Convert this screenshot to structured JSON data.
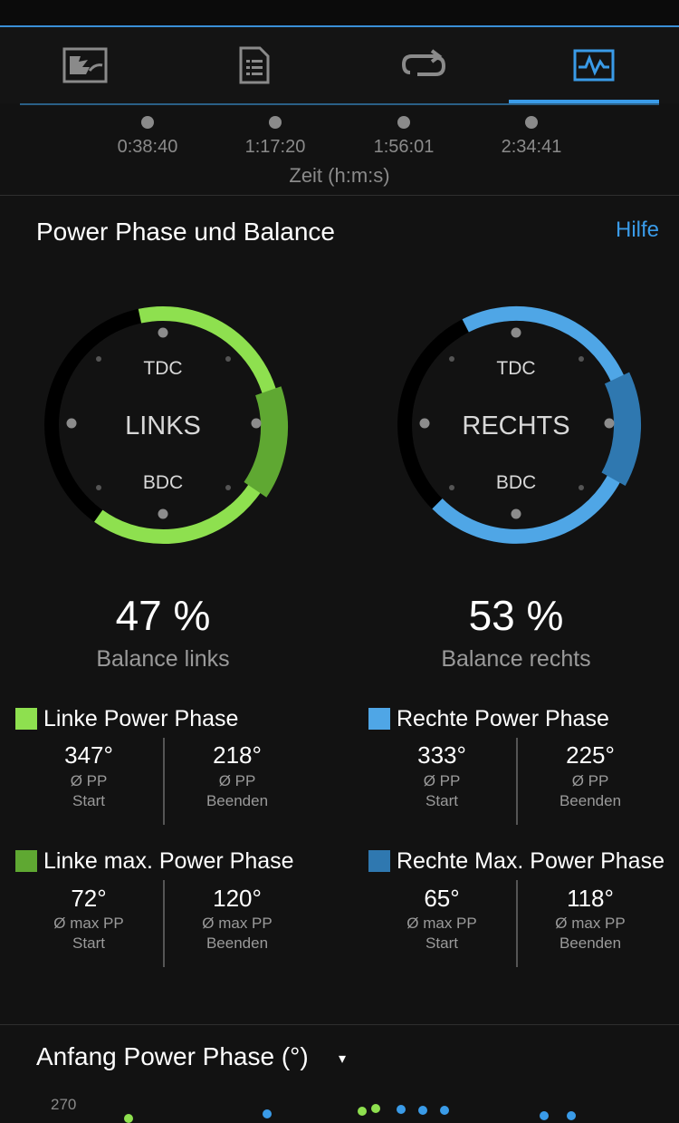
{
  "tabs": [
    {
      "icon": "map-course-icon"
    },
    {
      "icon": "document-list-icon"
    },
    {
      "icon": "loop-icon"
    },
    {
      "icon": "chart-activity-icon",
      "active": true
    }
  ],
  "time_axis": {
    "labels": [
      "0:38:40",
      "1:17:20",
      "1:56:01",
      "2:34:41"
    ],
    "title": "Zeit (h:m:s)"
  },
  "power_phase": {
    "title": "Power Phase und Balance",
    "help_label": "Hilfe",
    "left": {
      "name": "LINKS",
      "tdc": "TDC",
      "bdc": "BDC",
      "balance": "47 %",
      "balance_label": "Balance links",
      "phase_label": "Linke Power Phase",
      "pp_start": "347°",
      "pp_end": "218°",
      "max_label": "Linke max. Power Phase",
      "max_start": "72°",
      "max_end": "120°",
      "color_main": "#8ee04f",
      "color_max": "#5fa832"
    },
    "right": {
      "name": "RECHTS",
      "tdc": "TDC",
      "bdc": "BDC",
      "balance": "53 %",
      "balance_label": "Balance rechts",
      "phase_label": "Rechte Power Phase",
      "pp_start": "333°",
      "pp_end": "225°",
      "max_label": "Rechte Max. Power Phase",
      "max_start": "65°",
      "max_end": "118°",
      "color_main": "#4fa6e6",
      "color_max": "#2f78b0"
    },
    "pp_sub_line1": "Ø PP",
    "max_sub_line1": "Ø max PP",
    "start_label": "Start",
    "end_label": "Beenden"
  },
  "bottom_chart": {
    "title": "Anfang Power Phase (°)",
    "dropdown_glyph": "▾",
    "y_tick": "270"
  },
  "colors": {
    "accent": "#3a9be8",
    "background": "#121212",
    "ring_track": "#000000"
  }
}
